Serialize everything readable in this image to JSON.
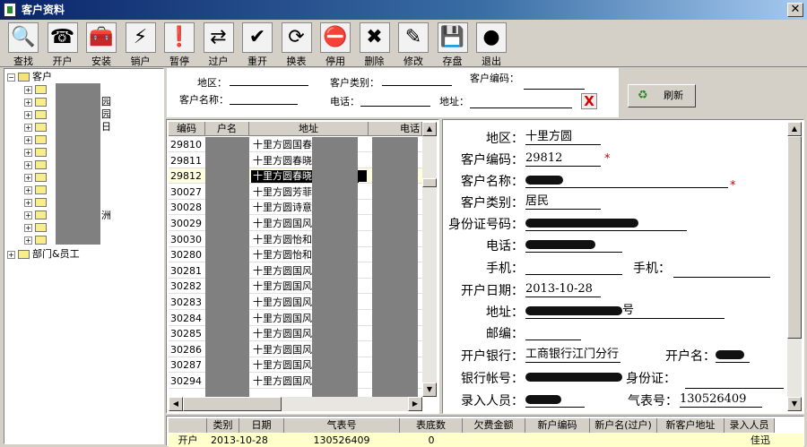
{
  "window": {
    "title": "客户资料",
    "close": "✕"
  },
  "toolbar": [
    {
      "label": "查找",
      "icon": "🔍"
    },
    {
      "label": "开户",
      "icon": "☎"
    },
    {
      "label": "安装",
      "icon": "🧰"
    },
    {
      "label": "销户",
      "icon": "⚡"
    },
    {
      "label": "暂停",
      "icon": "❗"
    },
    {
      "label": "过户",
      "icon": "⇄"
    },
    {
      "label": "重开",
      "icon": "✔"
    },
    {
      "label": "换表",
      "icon": "⟳"
    },
    {
      "label": "停用",
      "icon": "⛔"
    },
    {
      "label": "删除",
      "icon": "✖"
    },
    {
      "label": "修改",
      "icon": "✎"
    },
    {
      "label": "存盘",
      "icon": "💾"
    },
    {
      "label": "退出",
      "icon": "●"
    }
  ],
  "tree": {
    "root": "客户",
    "frag": [
      "园",
      "园",
      "日",
      "洲"
    ],
    "dept": "部门&员工"
  },
  "filter": {
    "region": "地区：",
    "type": "客户类别：",
    "code": "客户编码：",
    "name": "客户名称：",
    "phone": "电话：",
    "address": "地址：",
    "clear": "X",
    "refresh": "刷新"
  },
  "grid": {
    "headers": [
      "编码",
      "户名",
      "地址",
      "电话"
    ],
    "rows": [
      {
        "code": "29810",
        "addr": "十里方圆国春旸"
      },
      {
        "code": "29811",
        "addr": "十里方圆春晓5"
      },
      {
        "code": "29812",
        "addr": "十里方圆春晓8"
      },
      {
        "code": "30027",
        "addr": "十里方圆芳菲1"
      },
      {
        "code": "30028",
        "addr": "十里方圆诗意2"
      },
      {
        "code": "30029",
        "addr": "十里方圆国风和"
      },
      {
        "code": "30030",
        "addr": "十里方圆怡和5"
      },
      {
        "code": "30280",
        "addr": "十里方圆怡和1"
      },
      {
        "code": "30281",
        "addr": "十里方圆国风清"
      },
      {
        "code": "30282",
        "addr": "十里方圆国风清"
      },
      {
        "code": "30283",
        "addr": "十里方圆国风清"
      },
      {
        "code": "30284",
        "addr": "十里方圆国风和"
      },
      {
        "code": "30285",
        "addr": "十里方圆国风和"
      },
      {
        "code": "30286",
        "addr": "十里方圆国风清"
      },
      {
        "code": "30287",
        "addr": "十里方圆国风清"
      },
      {
        "code": "30294",
        "addr": "十里方圆国风清"
      }
    ],
    "selected": 2
  },
  "detail": {
    "region_l": "地区：",
    "region": "十里方圆",
    "code_l": "客户编码：",
    "code": "29812",
    "name_l": "客户名称：",
    "type_l": "客户类别：",
    "type": "居民",
    "id_l": "身份证号码：",
    "phone_l": "电话：",
    "mobile_l": "手机：",
    "mobile2_l": "手机：",
    "date_l": "开户日期：",
    "date": "2013-10-28",
    "addr_l": "地址：",
    "addr_tail": "号",
    "zip_l": "邮编：",
    "bank_l": "开户银行：",
    "bank": "工商银行江门分行",
    "acctname_l": "开户名：",
    "acct_l": "银行帐号：",
    "acct_id_l": "身份证：",
    "entry_l": "录入人员：",
    "meter_l": "气表号：",
    "meter": "130526409",
    "star": "*"
  },
  "history": {
    "headers": [
      "类别",
      "日期",
      "气表号",
      "表底数",
      "欠费金额",
      "新户编码",
      "新户名(过户)",
      "新客户地址",
      "录入人员"
    ],
    "row": [
      "开户",
      "2013-10-28",
      "130526409",
      "0",
      "",
      "",
      "",
      "",
      "佳迅"
    ]
  }
}
